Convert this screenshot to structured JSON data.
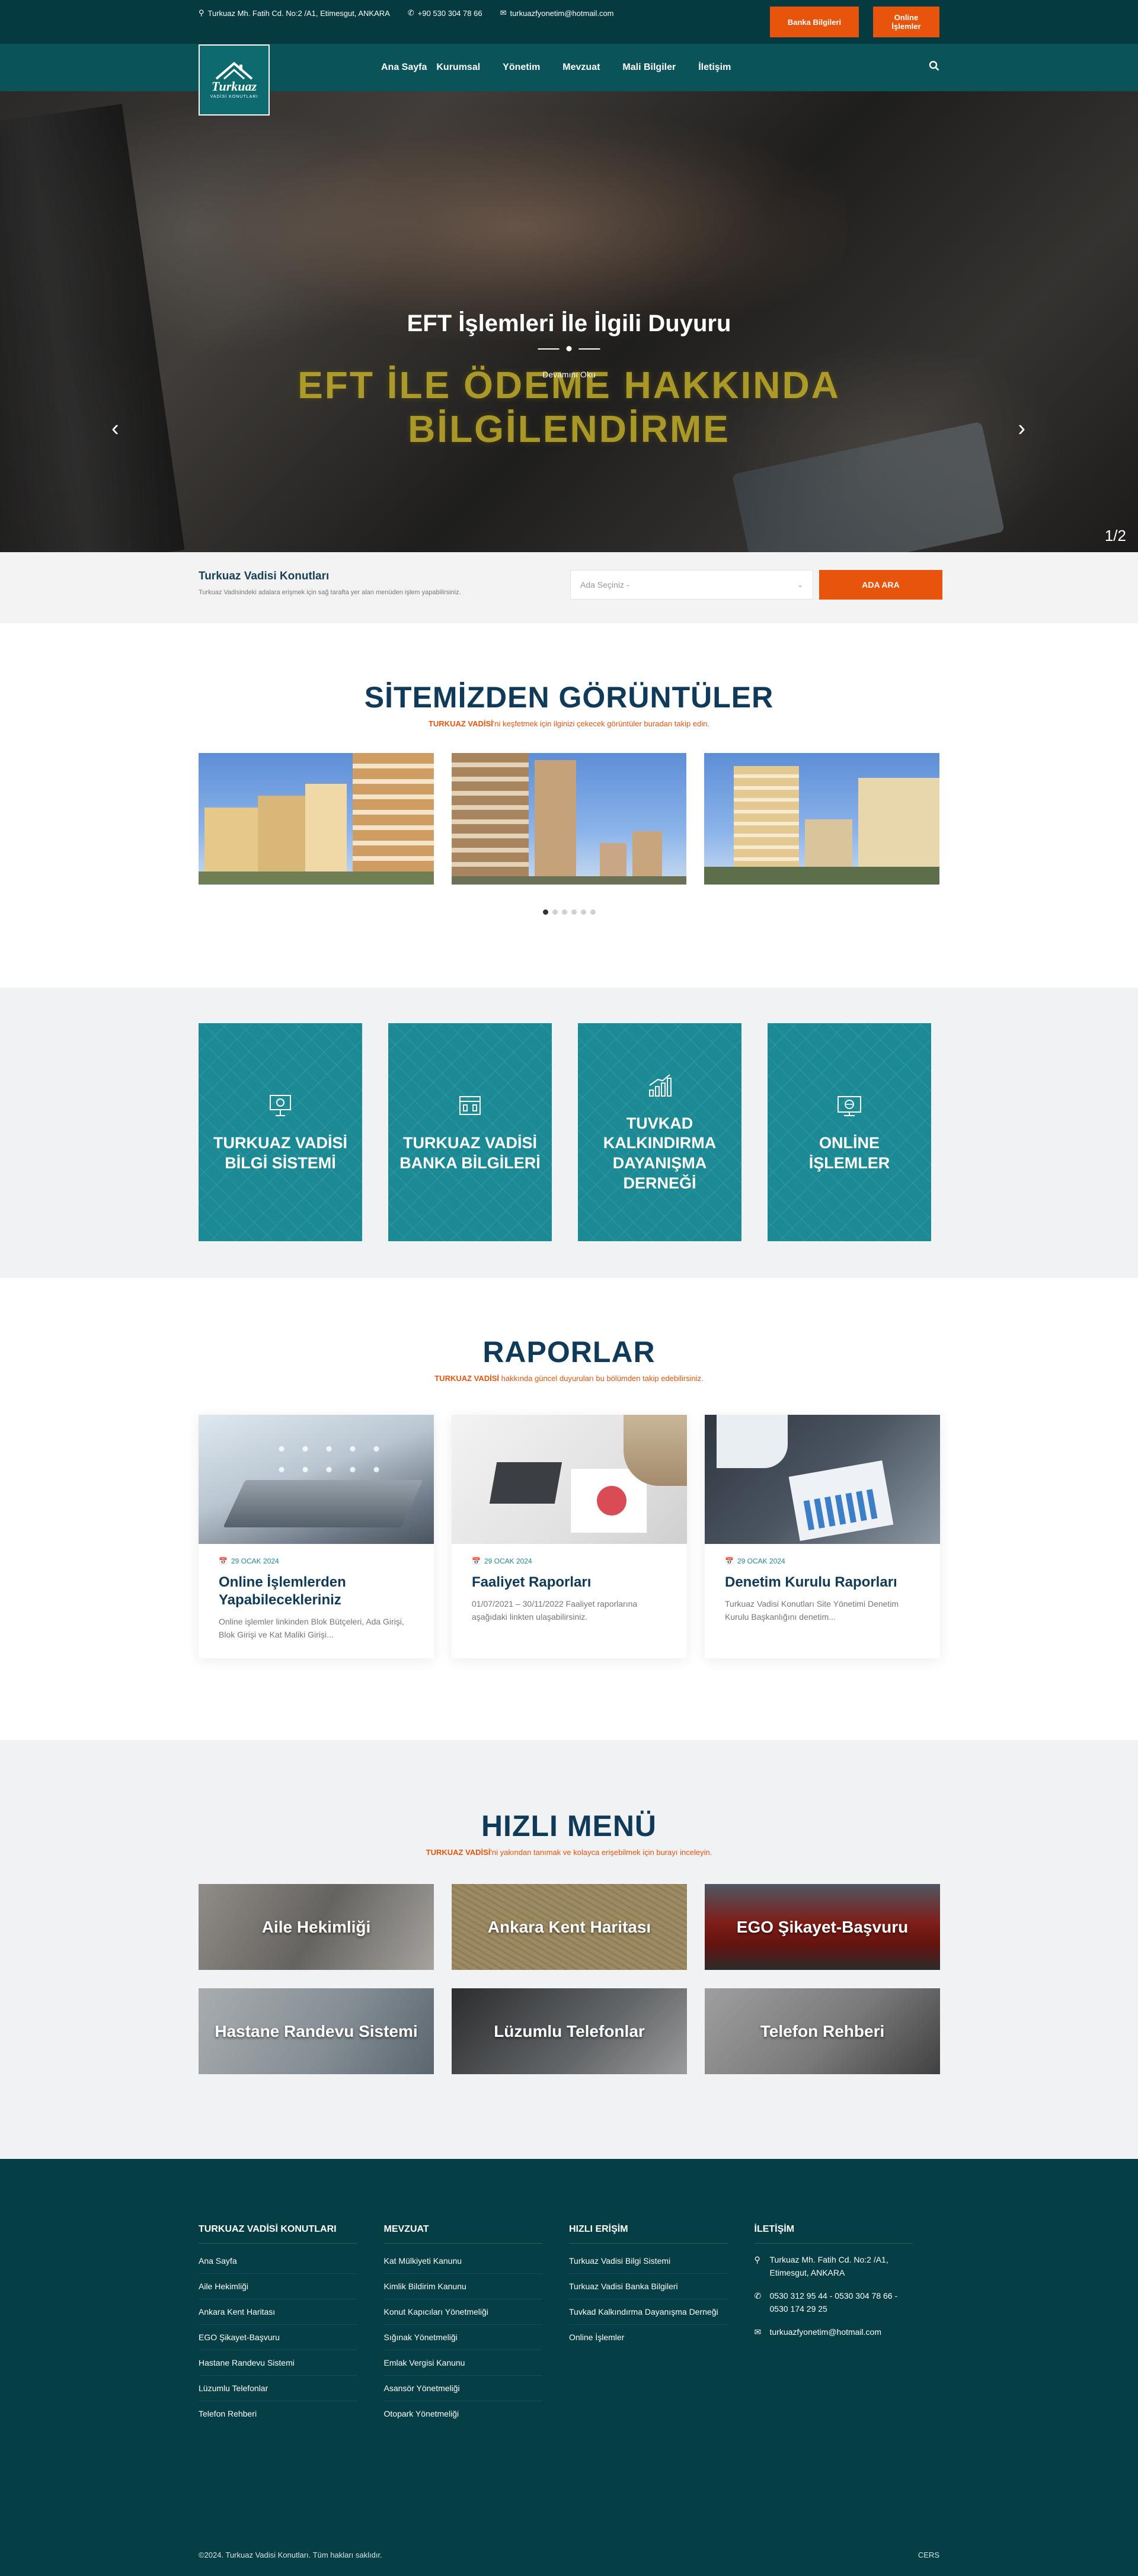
{
  "topbar": {
    "address": "Turkuaz Mh. Fatih Cd. No:2 /A1, Etimesgut, ANKARA",
    "phone": "+90 530 304 78 66",
    "email": "turkuazfyonetim@hotmail.com",
    "bank_button": "Banka Bilgileri",
    "online_button": "Online İşlemler"
  },
  "logo": {
    "name": "Turkuaz",
    "sub": "VADİSİ KONUTLARI"
  },
  "nav": {
    "items": [
      "Ana Sayfa",
      "Kurumsal",
      "Yönetim",
      "Mevzuat",
      "Mali Bilgiler",
      "İletişim"
    ]
  },
  "hero": {
    "title": "EFT İşlemleri İle İlgili Duyuru",
    "link": "Devamını Oku",
    "banner_line1": "EFT İLE ÖDEME HAKKINDA",
    "banner_line2": "BİLGİLENDİRME",
    "counter": "1/2"
  },
  "searchbar": {
    "title": "Turkuaz Vadisi Konutları",
    "desc": "Turkuaz Vadisindeki adalara erişmek için sağ tarafta yer alan menüden işlem yapabilirsiniz.",
    "select_placeholder": "Ada Seçiniz -",
    "button": "ADA ARA"
  },
  "gallery": {
    "title": "SİTEMİZDEN GÖRÜNTÜLER",
    "sub_brand": "TURKUAZ VADİSİ",
    "sub_rest": "'ni keşfetmek için ilginizi çekecek görüntüler buradan takip edin."
  },
  "tiles": [
    {
      "label": "TURKUAZ VADİSİ BİLGİ SİSTEMİ",
      "icon": "presentation-icon"
    },
    {
      "label": "TURKUAZ VADİSİ BANKA BİLGİLERİ",
      "icon": "bank-icon"
    },
    {
      "label": "TUVKAD KALKINDIRMA DAYANIŞMA DERNEĞİ",
      "icon": "chart-icon"
    },
    {
      "label": "ONLİNE İŞLEMLER",
      "icon": "monitor-icon"
    }
  ],
  "reports": {
    "title": "RAPORLAR",
    "sub_brand": "TURKUAZ VADİSİ",
    "sub_rest": " hakkında güncel duyuruları bu bölümden takip edebilirsiniz.",
    "items": [
      {
        "date": "29 OCAK 2024",
        "title": "Online İşlemlerden Yapabilecekleriniz",
        "text": "Online işlemler linkinden Blok Bütçeleri, Ada Girişi, Blok Girişi ve Kat Maliki Girişi..."
      },
      {
        "date": "29 OCAK 2024",
        "title": "Faaliyet Raporları",
        "text": "01/07/2021 – 30/11/2022 Faaliyet raporlarına aşağıdaki linkten ulaşabilirsiniz."
      },
      {
        "date": "29 OCAK 2024",
        "title": "Denetim Kurulu Raporları",
        "text": "Turkuaz Vadisi Konutları Site Yönetimi Denetim Kurulu Başkanlığını denetim..."
      }
    ]
  },
  "quick": {
    "title": "HIZLI MENÜ",
    "sub_brand": "TURKUAZ VADİSİ",
    "sub_rest": "'ni yakından tanımak ve kolayca erişebilmek için burayı inceleyin.",
    "items": [
      "Aile Hekimliği",
      "Ankara Kent Haritası",
      "EGO Şikayet-Başvuru",
      "Hastane Randevu Sistemi",
      "Lüzumlu Telefonlar",
      "Telefon Rehberi"
    ]
  },
  "footer": {
    "col1": {
      "title": "TURKUAZ VADİSİ KONUTLARI",
      "links": [
        "Ana Sayfa",
        "Aile Hekimliği",
        "Ankara Kent Haritası",
        "EGO Şikayet-Başvuru",
        "Hastane Randevu Sistemi",
        "Lüzumlu Telefonlar",
        "Telefon Rehberi"
      ]
    },
    "col2": {
      "title": "MEVZUAT",
      "links": [
        "Kat Mülkiyeti Kanunu",
        "Kimlik Bildirim Kanunu",
        "Konut Kapıcıları Yönetmeliği",
        "Sığınak Yönetmeliği",
        "Emlak Vergisi Kanunu",
        "Asansör Yönetmeliği",
        "Otopark Yönetmeliği"
      ]
    },
    "col3": {
      "title": "HIZLI ERİŞİM",
      "links": [
        "Turkuaz Vadisi Bilgi Sistemi",
        "Turkuaz Vadisi Banka Bilgileri",
        "Tuvkad Kalkındırma Dayanışma Derneği",
        "Online İşlemler"
      ]
    },
    "col4": {
      "title": "İLETİŞİM",
      "address": "Turkuaz Mh. Fatih Cd. No:2 /A1, Etimesgut, ANKARA",
      "phones": "0530 312 95 44 - 0530 304 78 66 - 0530 174 29 25",
      "email": "turkuazfyonetim@hotmail.com"
    },
    "copyright": "©2024. Turkuaz Vadisi Konutları. Tüm hakları saklıdır.",
    "credit": "CERS"
  }
}
